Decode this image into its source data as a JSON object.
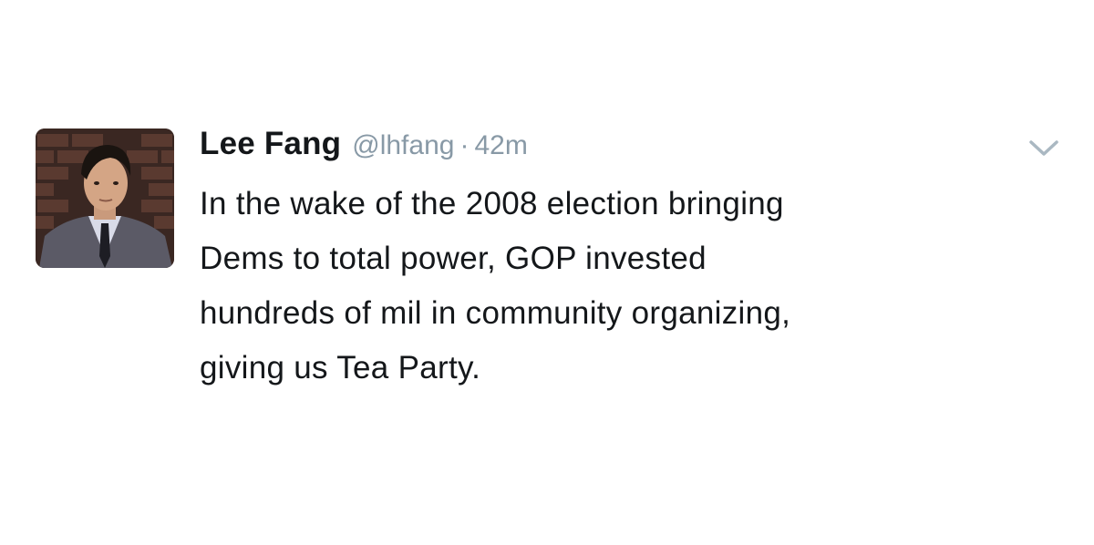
{
  "tweet": {
    "display_name": "Lee Fang",
    "handle": "@lhfang",
    "separator": "·",
    "time": "42m",
    "text_lines": [
      "In the wake of the 2008 election bringing",
      "Dems to total power, GOP invested",
      "hundreds of mil in community organizing,",
      "giving us Tea Party."
    ],
    "caret_icon": "chevron-down-icon",
    "avatar_icon": "profile-photo"
  },
  "colors": {
    "text": "#14171a",
    "secondary": "#8899a6",
    "caret": "#aab8c2"
  }
}
